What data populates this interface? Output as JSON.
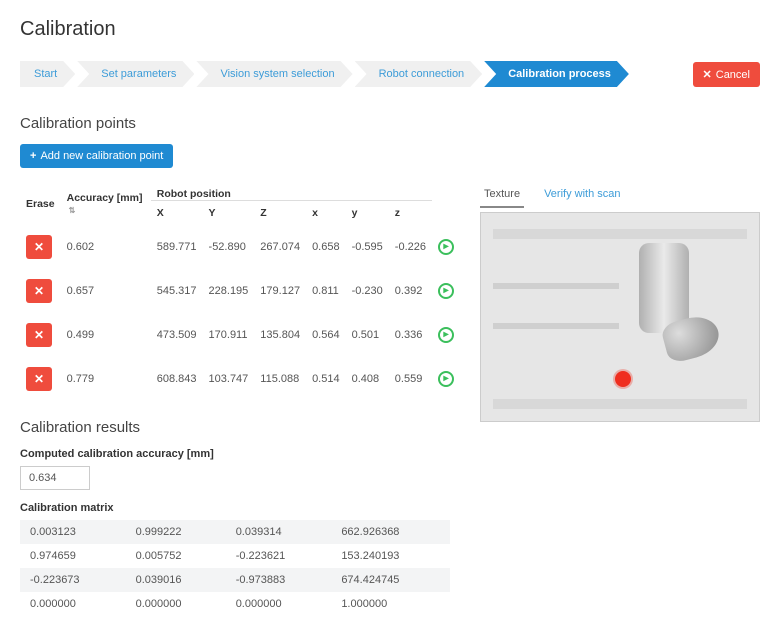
{
  "page_title": "Calibration",
  "wizard_steps": [
    {
      "label": "Start",
      "active": false
    },
    {
      "label": "Set parameters",
      "active": false
    },
    {
      "label": "Vision system selection",
      "active": false
    },
    {
      "label": "Robot connection",
      "active": false
    },
    {
      "label": "Calibration process",
      "active": true
    }
  ],
  "cancel_label": "Cancel",
  "points_section_title": "Calibration points",
  "add_point_label": "Add new calibration point",
  "table_headers": {
    "erase": "Erase",
    "accuracy": "Accuracy [mm]",
    "robot_position_group": "Robot position",
    "X": "X",
    "Y": "Y",
    "Z": "Z",
    "x_lc": "x",
    "y_lc": "y",
    "z_lc": "z"
  },
  "points": [
    {
      "accuracy": "0.602",
      "X": "589.771",
      "Y": "-52.890",
      "Z": "267.074",
      "x": "0.658",
      "y": "-0.595",
      "z": "-0.226"
    },
    {
      "accuracy": "0.657",
      "X": "545.317",
      "Y": "228.195",
      "Z": "179.127",
      "x": "0.811",
      "y": "-0.230",
      "z": "0.392"
    },
    {
      "accuracy": "0.499",
      "X": "473.509",
      "Y": "170.911",
      "Z": "135.804",
      "x": "0.564",
      "y": "0.501",
      "z": "0.336"
    },
    {
      "accuracy": "0.779",
      "X": "608.843",
      "Y": "103.747",
      "Z": "115.088",
      "x": "0.514",
      "y": "0.408",
      "z": "0.559"
    }
  ],
  "preview_tabs": [
    {
      "label": "Texture",
      "active": true
    },
    {
      "label": "Verify with scan",
      "active": false
    }
  ],
  "results_section_title": "Calibration results",
  "computed_accuracy_label": "Computed calibration accuracy [mm]",
  "computed_accuracy_value": "0.634",
  "matrix_label": "Calibration matrix",
  "matrix": [
    [
      "0.003123",
      "0.999222",
      "0.039314",
      "662.926368"
    ],
    [
      "0.974659",
      "0.005752",
      "-0.223621",
      "153.240193"
    ],
    [
      "-0.223673",
      "0.039016",
      "-0.973883",
      "674.424745"
    ],
    [
      "0.000000",
      "0.000000",
      "0.000000",
      "1.000000"
    ]
  ]
}
